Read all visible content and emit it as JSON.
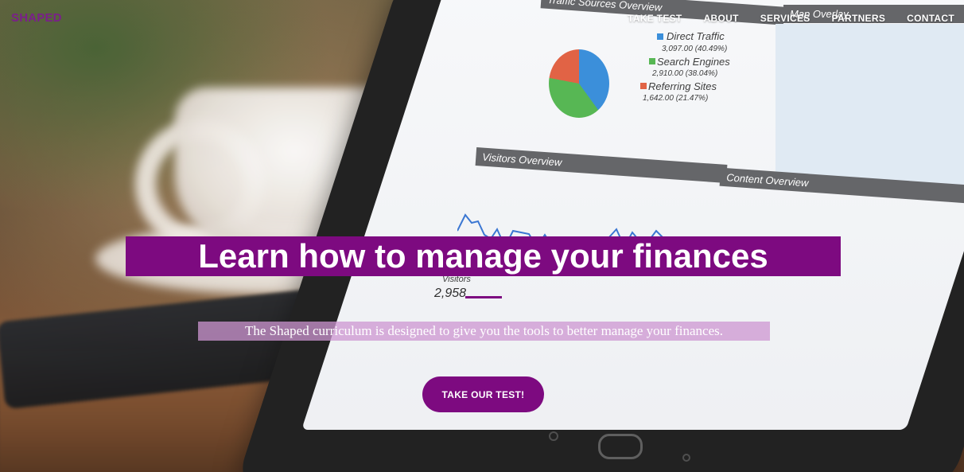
{
  "brand": {
    "name": "SHAPED",
    "color": "#7a1f8a"
  },
  "nav": {
    "items": [
      {
        "label": "TAKE TEST"
      },
      {
        "label": "ABOUT"
      },
      {
        "label": "SERVICES"
      },
      {
        "label": "PARTNERS"
      },
      {
        "label": "CONTACT"
      }
    ]
  },
  "hero": {
    "title": "Learn how to manage your finances",
    "subtitle": "The Shaped curriculum is designed to give you the tools to better manage your finances.",
    "cta_label": "TAKE OUR TEST!",
    "accent_color": "#7d0a80"
  },
  "background_screen": {
    "traffic_title": "Traffic Sources Overview",
    "legend": [
      {
        "name": "Direct Traffic",
        "value": "3,097.00 (40.49%)",
        "color": "#2f88d8"
      },
      {
        "name": "Search Engines",
        "value": "2,910.00 (38.04%)",
        "color": "#4db34a"
      },
      {
        "name": "Referring Sites",
        "value": "1,642.00 (21.47%)",
        "color": "#e05a3a"
      }
    ],
    "visitors_title": "Visitors Overview",
    "visitors_label": "Visitors",
    "visitors_value": "2,958",
    "content_title": "Content Overview",
    "map_title": "Map Overlay"
  }
}
